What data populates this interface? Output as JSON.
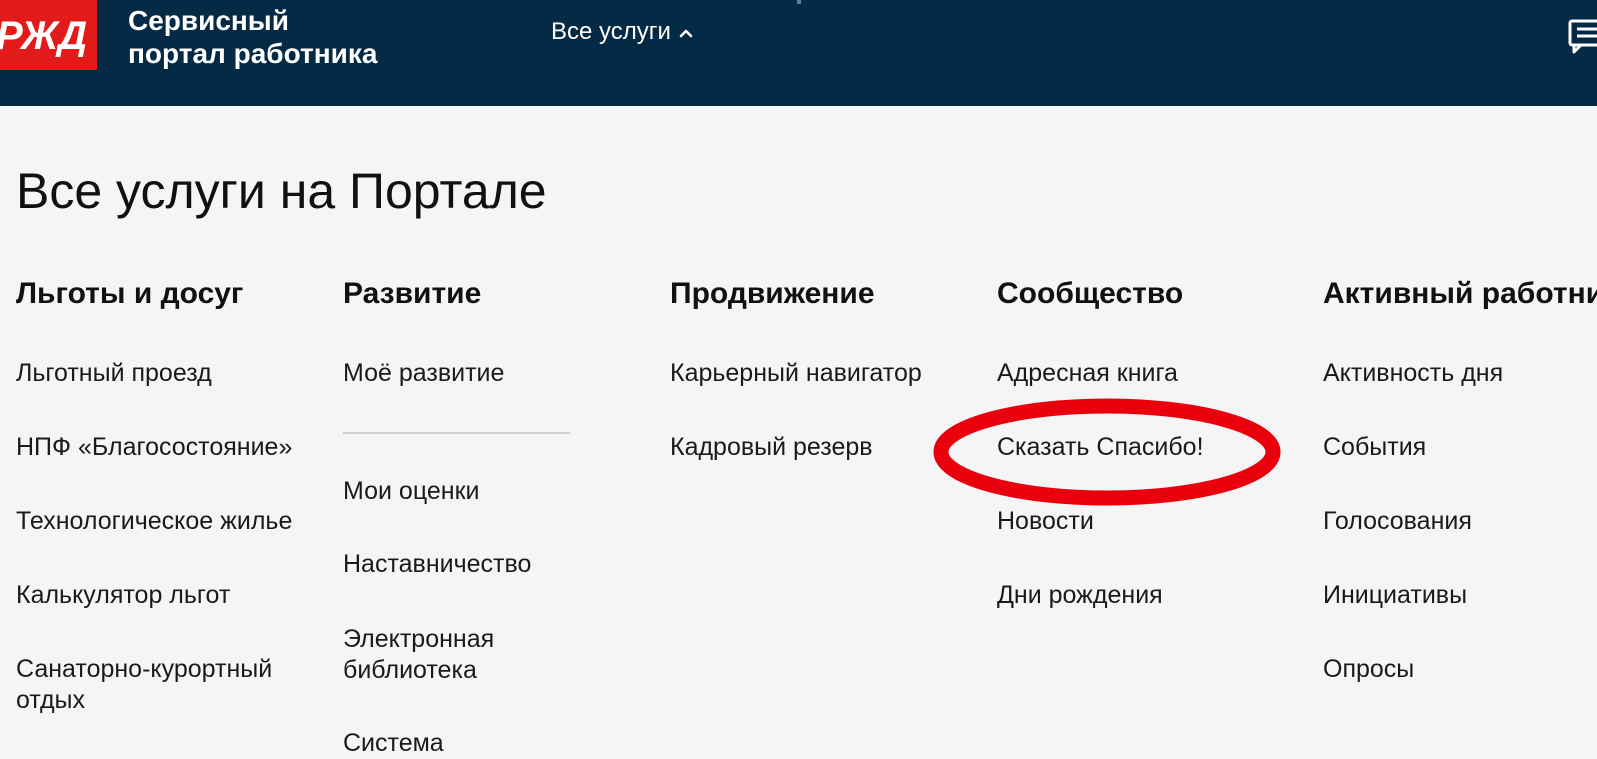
{
  "header": {
    "logo_text": "РЖД",
    "brand_line1": "Сервисный",
    "brand_line2": "портал работника",
    "nav_label": "Все услуги"
  },
  "page": {
    "title": "Все услуги на Портале"
  },
  "columns": [
    {
      "title": "Льготы и досуг",
      "items": [
        "Льготный проезд",
        "НПФ «Благосостояние»",
        "Технологическое жилье",
        "Калькулятор льгот",
        "Санаторно-курортный",
        "отдых"
      ]
    },
    {
      "title": "Развитие",
      "items": [
        "Моё развитие",
        "Мои оценки",
        "Наставничество",
        "Электронная",
        "библиотека",
        "Система"
      ]
    },
    {
      "title": "Продвижение",
      "items": [
        "Карьерный навигатор",
        "Кадровый резерв"
      ]
    },
    {
      "title": "Сообщество",
      "items": [
        "Адресная книга",
        "Сказать Спасибо!",
        "Новости",
        "Дни рождения"
      ]
    },
    {
      "title": "Активный работник",
      "items": [
        "Активность дня",
        "События",
        "Голосования",
        "Инициативы",
        "Опросы"
      ]
    }
  ],
  "colors": {
    "header_bg": "#052a45",
    "logo_bg": "#e21a1a",
    "highlight": "#e8000d"
  }
}
